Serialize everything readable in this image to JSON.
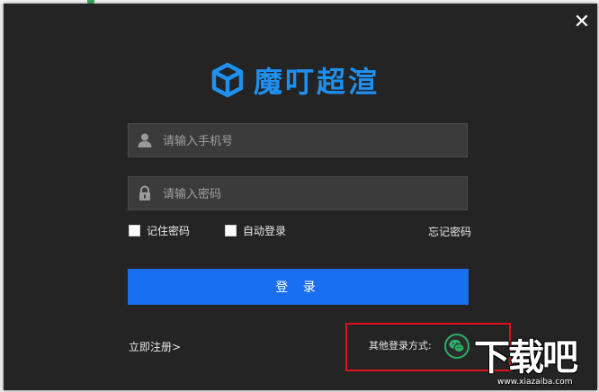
{
  "colors": {
    "accent": "#1a6ef0",
    "logo": "#1e90f0",
    "dialog_bg": "#242424",
    "wechat": "#2aae67",
    "highlight": "#e0101a"
  },
  "window": {
    "close_icon": "✕"
  },
  "logo": {
    "text": "魔叮超渲",
    "icon": "cube-icon"
  },
  "form": {
    "phone_placeholder": "请输入手机号",
    "phone_value": "",
    "password_placeholder": "请输入密码",
    "password_value": "",
    "remember_label": "记住密码",
    "autologin_label": "自动登录",
    "forgot_label": "忘记密码",
    "login_button": "登 录"
  },
  "footer": {
    "register_link": "立即注册>",
    "other_login_label": "其他登录方式:",
    "wechat_icon": "wechat-icon"
  },
  "watermark": {
    "text": "下载吧",
    "url": "www.xiazaiba.com"
  }
}
